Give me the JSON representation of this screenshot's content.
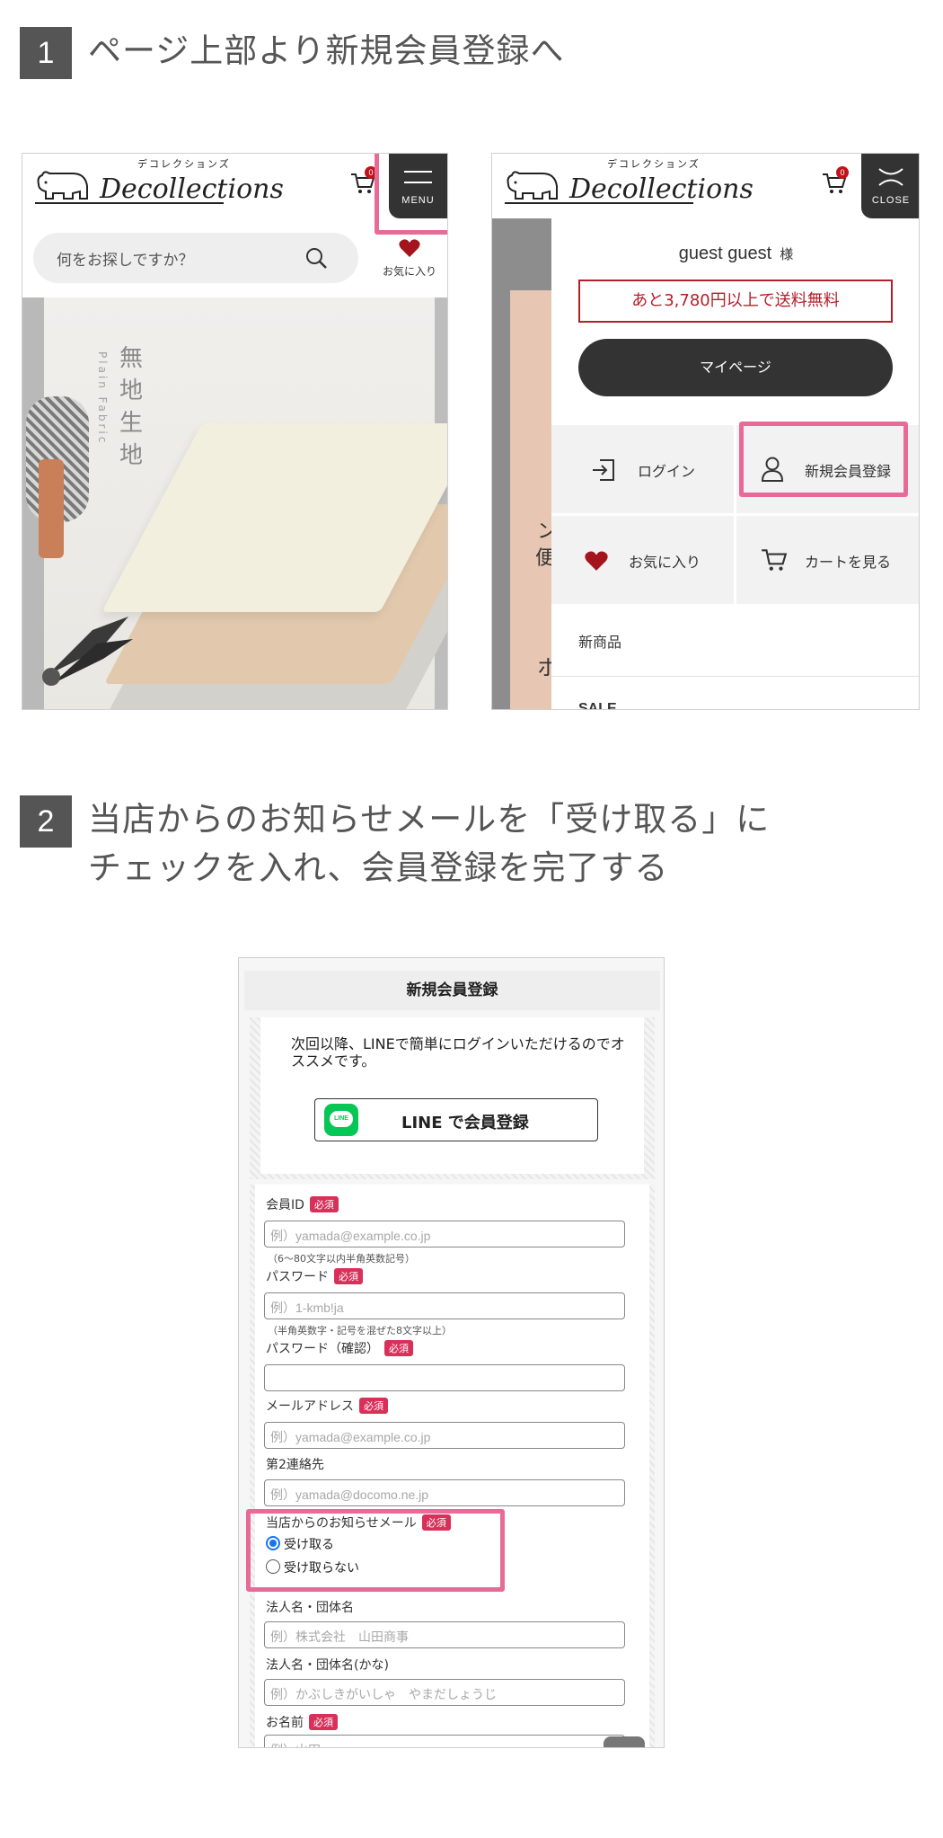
{
  "step1": {
    "number": "1",
    "title": "ページ上部より新規会員登録へ"
  },
  "step2": {
    "number": "2",
    "title_line1": "当店からのお知らせメールを「受け取る」に",
    "title_line2": "チェックを入れ、会員登録を完了する"
  },
  "brand": {
    "logo_kana": "デコレクションズ",
    "logo_word": "Decollections"
  },
  "phone1": {
    "cart_count": "0",
    "menu_label": "MENU",
    "search_placeholder": "何をお探しですか？",
    "favorites_label": "お気に入り",
    "hero_title": "無地生地",
    "hero_subtitle": "Plain Fabric"
  },
  "phone2": {
    "cart_count": "0",
    "close_label": "CLOSE",
    "user_name": "guest guest",
    "user_suffix": "様",
    "shipping_notice": "あと3,780円以上で送料無料",
    "mypage_label": "マイページ",
    "login_label": "ログイン",
    "register_label": "新規会員登録",
    "favorites_label": "お気に入り",
    "cart_label": "カートを見る",
    "new_items_label": "新商品",
    "sale_label": "SALE",
    "bg_char1": "ン",
    "bg_char2": "便",
    "bg_char3": "ホ"
  },
  "form": {
    "title": "新規会員登録",
    "line_intro": "次回以降、LINEで簡単にログインいただけるのでオススメです。",
    "line_icon_text": "LINE",
    "line_button": "LINE で会員登録",
    "required_tag": "必須",
    "member_id_label": "会員ID",
    "member_id_placeholder": "例）yamada@example.co.jp",
    "member_id_hint": "（6〜80文字以内半角英数記号）",
    "password_label": "パスワード",
    "password_placeholder": "例）1-kmb!ja",
    "password_hint": "（半角英数字・記号を混ぜた8文字以上）",
    "password_confirm_label": "パスワード（確認）",
    "email_label": "メールアドレス",
    "email_placeholder": "例）yamada@example.co.jp",
    "second_contact_label": "第2連絡先",
    "second_contact_placeholder": "例）yamada@docomo.ne.jp",
    "newsletter_label": "当店からのお知らせメール",
    "newsletter_options": [
      "受け取る",
      "受け取らない"
    ],
    "newsletter_selected": "受け取る",
    "company_label": "法人名・団体名",
    "company_placeholder": "例）株式会社　山田商事",
    "company_kana_label": "法人名・団体名(かな)",
    "company_kana_placeholder": "例）かぶしきがいしゃ　やまだしょうじ",
    "name_label": "お名前",
    "name_placeholder": "例）山田"
  },
  "colors": {
    "highlight": "#e86a96",
    "dark": "#333333",
    "required": "#d9305a",
    "shipping_red": "#b3202a",
    "heart": "#a3141c",
    "line_green": "#06c755",
    "radio_blue": "#1a73e8"
  }
}
